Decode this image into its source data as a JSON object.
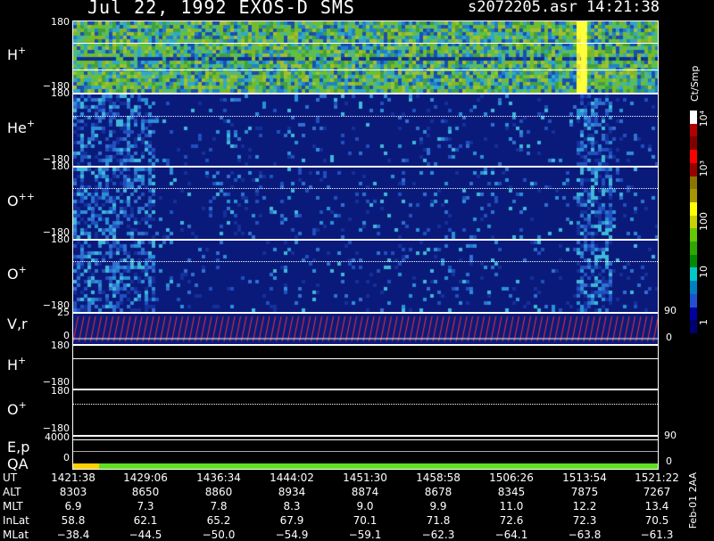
{
  "header": {
    "date_mission": "Jul 22, 1992   EXOS-D SMS",
    "file_time": "s2072205.asr  14:21:38"
  },
  "panels": {
    "hplus": {
      "label": "H",
      "sup": "+",
      "top_tick": "180",
      "bot_tick": "−180"
    },
    "heplus": {
      "label": "He",
      "sup": "+",
      "top_tick": "180",
      "bot_tick": "−180"
    },
    "oplusplus": {
      "label": "O",
      "sup": "++",
      "top_tick": "180",
      "bot_tick": "−180"
    },
    "oplus": {
      "label": "O",
      "sup": "+",
      "top_tick": "180",
      "bot_tick": "−180"
    },
    "vr": {
      "label": "V,r",
      "top_tick": "25",
      "bot_tick": "0",
      "right_top": "90",
      "right_bot": "0"
    },
    "hplus2": {
      "label": "H",
      "sup": "+",
      "top_tick": "180",
      "bot_tick": "−180"
    },
    "oplus2": {
      "label": "O",
      "sup": "+",
      "top_tick": "180",
      "bot_tick": "−180"
    },
    "ep": {
      "label": "E,p",
      "top_tick": "4000",
      "bot_tick": "0",
      "right_top": "90"
    },
    "qa": {
      "label": "QA",
      "right_bot": "0"
    }
  },
  "colorbar": {
    "label": "Ct/Smp",
    "ticks": [
      "10⁴",
      "10³",
      "100",
      "10",
      "1"
    ],
    "colors": [
      "#ffffff",
      "#b30000",
      "#800000",
      "#ff0000",
      "#990000",
      "#8b7500",
      "#a89600",
      "#ffff00",
      "#c8d200",
      "#66c800",
      "#2ea800",
      "#008a00",
      "#00c8c8",
      "#0080c0",
      "#2050d0",
      "#0000a0",
      "#000070"
    ]
  },
  "time_table": {
    "rows": [
      {
        "label": "UT",
        "values": [
          "1421:38",
          "1429:06",
          "1436:34",
          "1444:02",
          "1451:30",
          "1458:58",
          "1506:26",
          "1513:54",
          "1521:22"
        ]
      },
      {
        "label": "ALT",
        "values": [
          "8303",
          "8650",
          "8860",
          "8934",
          "8874",
          "8678",
          "8345",
          "7875",
          "7267"
        ]
      },
      {
        "label": "MLT",
        "values": [
          "6.9",
          "7.3",
          "7.8",
          "8.3",
          "9.0",
          "9.9",
          "11.0",
          "12.2",
          "13.4"
        ]
      },
      {
        "label": "InLat",
        "values": [
          "58.8",
          "62.1",
          "65.2",
          "67.9",
          "70.1",
          "71.8",
          "72.6",
          "72.3",
          "70.5"
        ]
      },
      {
        "label": "MLat",
        "values": [
          "−38.4",
          "−44.5",
          "−50.0",
          "−54.9",
          "−59.1",
          "−62.3",
          "−64.1",
          "−63.8",
          "−61.3"
        ]
      }
    ]
  },
  "footer_stamp": "Feb-01 2AA"
}
